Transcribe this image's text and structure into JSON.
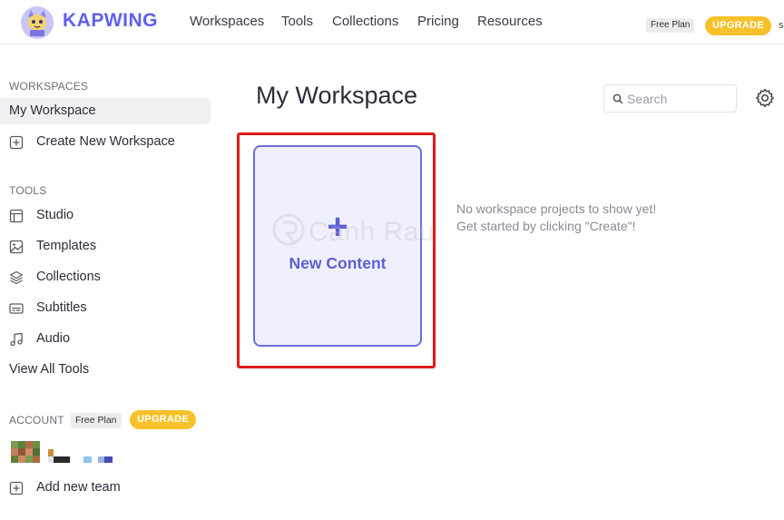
{
  "brand": {
    "name": "KAPWING",
    "logo_icon": "kapwing-cat-logo"
  },
  "nav": {
    "links": [
      {
        "label": "Workspaces"
      },
      {
        "label": "Tools"
      },
      {
        "label": "Collections"
      },
      {
        "label": "Pricing"
      },
      {
        "label": "Resources"
      }
    ],
    "plan_badge": "Free Plan",
    "upgrade_label": "UPGRADE",
    "avatar_text": "s"
  },
  "sidebar": {
    "workspaces_heading": "WORKSPACES",
    "workspace_items": [
      {
        "label": "My Workspace",
        "active": true
      },
      {
        "label": "Create New Workspace",
        "icon": "plus-square-icon"
      }
    ],
    "tools_heading": "TOOLS",
    "tool_items": [
      {
        "label": "Studio",
        "icon": "layout-icon"
      },
      {
        "label": "Templates",
        "icon": "image-icon"
      },
      {
        "label": "Collections",
        "icon": "layers-icon"
      },
      {
        "label": "Subtitles",
        "icon": "subtitles-icon"
      },
      {
        "label": "Audio",
        "icon": "music-icon"
      },
      {
        "label": "View All Tools"
      }
    ],
    "account_heading": "ACCOUNT",
    "account_plan_badge": "Free Plan",
    "account_upgrade_label": "UPGRADE",
    "add_team_label": "Add new team"
  },
  "main": {
    "title": "My Workspace",
    "search_placeholder": "Search",
    "new_content_label": "New Content",
    "empty_line1": "No workspace projects to show yet!",
    "empty_line2": "Get started by clicking \"Create\"!"
  },
  "watermark": {
    "text": "Canh Rau"
  },
  "colors": {
    "brand": "#5d5fef",
    "upgrade": "#f6c12a",
    "highlight_border": "#e01b1b",
    "card_bg": "#eff0fb",
    "card_border": "#6b6dd8"
  }
}
